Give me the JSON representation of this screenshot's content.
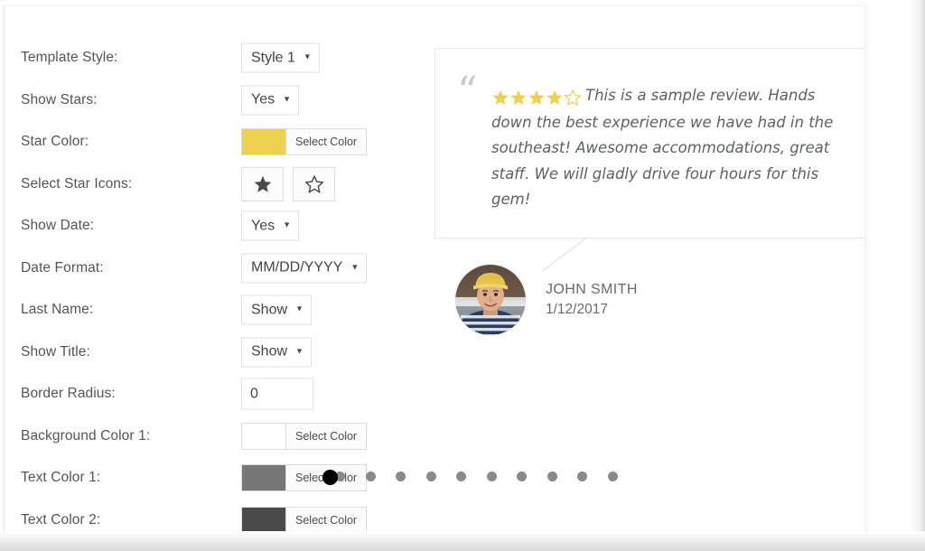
{
  "form": {
    "rows": [
      {
        "label": "Template Style:",
        "type": "select",
        "value": "Style 1",
        "name": "template-style"
      },
      {
        "label": "Show Stars:",
        "type": "select",
        "value": "Yes",
        "name": "show-stars"
      },
      {
        "label": "Star Color:",
        "type": "color",
        "value": "Select Color",
        "swatch": "#edd24f",
        "name": "star-color"
      },
      {
        "label": "Select Star Icons:",
        "type": "stars",
        "value": "",
        "name": "select-star-icons"
      },
      {
        "label": "Show Date:",
        "type": "select",
        "value": "Yes",
        "name": "show-date"
      },
      {
        "label": "Date Format:",
        "type": "select",
        "value": "MM/DD/YYYY",
        "name": "date-format"
      },
      {
        "label": "Last Name:",
        "type": "select",
        "value": "Show",
        "name": "last-name"
      },
      {
        "label": "Show Title:",
        "type": "select",
        "value": "Show",
        "name": "show-title"
      },
      {
        "label": "Border Radius:",
        "type": "text",
        "value": "0",
        "placeholder": "0",
        "name": "border-radius"
      },
      {
        "label": "Background Color 1:",
        "type": "color",
        "value": "Select Color",
        "swatch": "#ffffff",
        "name": "background-color-1"
      },
      {
        "label": "Text Color 1:",
        "type": "color",
        "value": "Select Color",
        "swatch": "#777777",
        "name": "text-color-1"
      },
      {
        "label": "Text Color 2:",
        "type": "color",
        "value": "Select Color",
        "swatch": "#4a4a4a",
        "name": "text-color-2"
      }
    ],
    "star_icon_options": [
      "star-filled-icon",
      "star-outline-icon"
    ],
    "star_icon_selected_index": 0,
    "caret_glyph": "▼"
  },
  "preview": {
    "quote_glyph": "“",
    "rating_filled": 4,
    "rating_total": 5,
    "star_color": "#edd24f",
    "review_text": "This is a sample review. Hands down the best experience we have had in the southeast! Awesome accommodations, great staff. We will gladly drive four hours for this gem!",
    "author_name": "JOHN SMITH",
    "author_date": "1/12/2017",
    "avatar_alt": "user-avatar-photo"
  },
  "pager": {
    "dot_count": 10,
    "dot_color": "#8a8a8a",
    "cursor_color": "#000000"
  }
}
